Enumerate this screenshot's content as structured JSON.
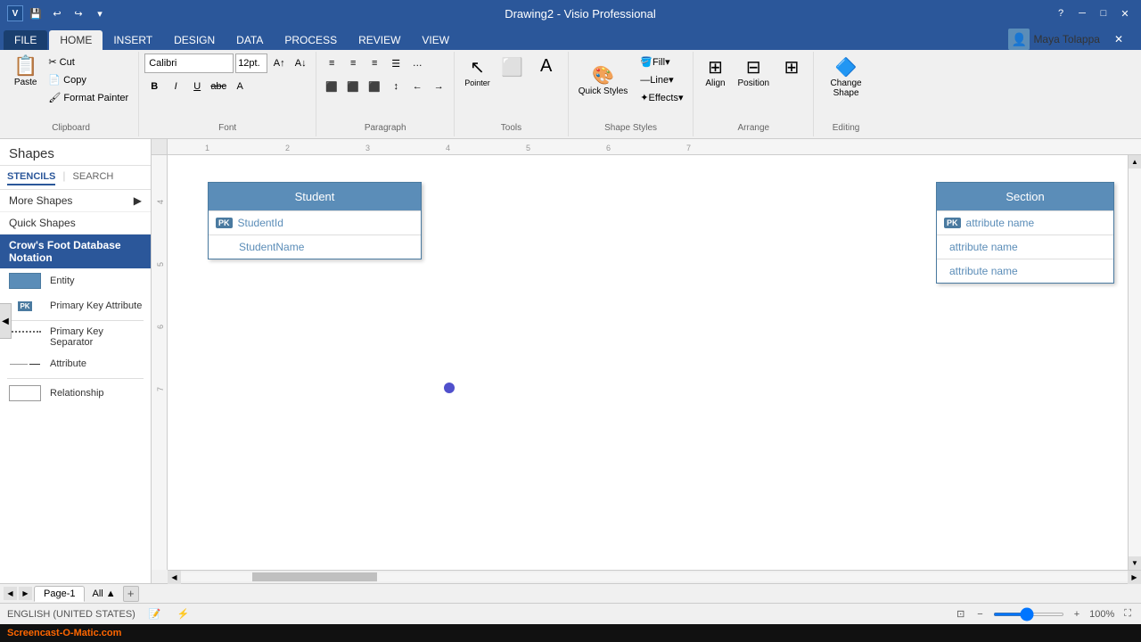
{
  "app": {
    "title": "Drawing2 - Visio Professional",
    "user": "Maya Tolappa",
    "help_icon": "?",
    "minimize_icon": "─",
    "maximize_icon": "□",
    "close_icon": "✕"
  },
  "ribbon": {
    "tabs": [
      "FILE",
      "HOME",
      "INSERT",
      "DESIGN",
      "DATA",
      "PROCESS",
      "REVIEW",
      "VIEW"
    ],
    "active_tab": "HOME",
    "groups": {
      "clipboard": {
        "label": "Clipboard",
        "paste_label": "Paste"
      },
      "font": {
        "label": "Font",
        "font_name": "Calibri",
        "font_size": "12pt.",
        "bold": "B",
        "italic": "I",
        "underline": "U",
        "strikethrough": "abc"
      },
      "paragraph": {
        "label": "Paragraph"
      },
      "tools": {
        "label": "Tools"
      },
      "shape_styles": {
        "label": "Shape Styles",
        "fill_label": "Fill",
        "line_label": "Line",
        "effects_label": "Effects",
        "quick_styles_label": "Quick Styles"
      },
      "arrange": {
        "label": "Arrange",
        "align_label": "Align",
        "position_label": "Position"
      },
      "editing": {
        "label": "Editing",
        "change_shape_label": "Change Shape"
      }
    }
  },
  "sidebar": {
    "title": "Shapes",
    "stencils_tab": "STENCILS",
    "search_tab": "SEARCH",
    "more_shapes_label": "More Shapes",
    "quick_shapes_label": "Quick Shapes",
    "stencil_name": "Crow's Foot Database Notation",
    "shapes": [
      {
        "id": "entity",
        "label": "Entity",
        "type": "entity"
      },
      {
        "id": "pk-attr",
        "label": "Primary Key Attribute",
        "type": "pk-attr"
      },
      {
        "id": "pk-sep",
        "label": "Primary Key Separator",
        "type": "pk-sep"
      },
      {
        "id": "attribute",
        "label": "Attribute",
        "type": "attribute"
      },
      {
        "id": "relationship",
        "label": "Relationship",
        "type": "relationship"
      }
    ]
  },
  "canvas": {
    "student_entity": {
      "title": "Student",
      "rows": [
        {
          "pk": true,
          "label": "StudentId"
        },
        {
          "pk": false,
          "label": "StudentName"
        }
      ]
    },
    "section_entity": {
      "title": "Section",
      "rows": [
        {
          "pk": true,
          "label": "attribute name"
        },
        {
          "pk": false,
          "label": "attribute name"
        },
        {
          "pk": false,
          "label": "attribute name"
        }
      ]
    }
  },
  "statusbar": {
    "page_label": "Page-1",
    "all_label": "All",
    "language": "ENGLISH (UNITED STATES)",
    "zoom_level": "100%"
  },
  "screencast": {
    "label": "Screencast-O-Matic.com"
  }
}
